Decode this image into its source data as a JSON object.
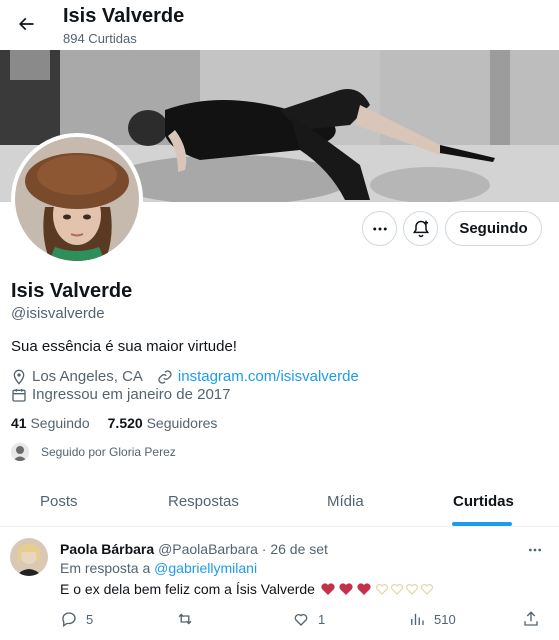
{
  "header": {
    "title": "Isis Valverde",
    "subtitle": "894 Curtidas",
    "back_icon": "arrow-left-icon"
  },
  "profile": {
    "name": "Isis Valverde",
    "handle": "@isisvalverde",
    "bio": "Sua essência é sua maior virtude!",
    "location": "Los Angeles, CA",
    "website": "instagram.com/isisvalverde",
    "joined": "Ingressou em janeiro de 2017",
    "following_count": "41",
    "following_label": "Seguindo",
    "followers_count": "7.520",
    "followers_label": "Seguidores",
    "followed_by": "Seguido por Gloria Perez"
  },
  "actions": {
    "more_icon": "ellipsis-icon",
    "notify_icon": "bell-plus-icon",
    "follow_label": "Seguindo"
  },
  "tabs": [
    {
      "label": "Posts",
      "active": false
    },
    {
      "label": "Respostas",
      "active": false
    },
    {
      "label": "Mídia",
      "active": false
    },
    {
      "label": "Curtidas",
      "active": true
    }
  ],
  "tweet": {
    "author_name": "Paola Bárbara",
    "author_handle": "@PaolaBarbara",
    "separator": "·",
    "date": "26 de set",
    "reply_prefix": "Em resposta a",
    "reply_to": "@gabriellymilani",
    "text": "E o ex dela bem feliz com a Ísis Valverde",
    "replies": "5",
    "retweets": "",
    "likes": "1",
    "views": "510"
  },
  "colors": {
    "accent": "#1d9bf0",
    "secondary_text": "#536471",
    "primary_text": "#0f1419",
    "border": "#cfd9de"
  }
}
